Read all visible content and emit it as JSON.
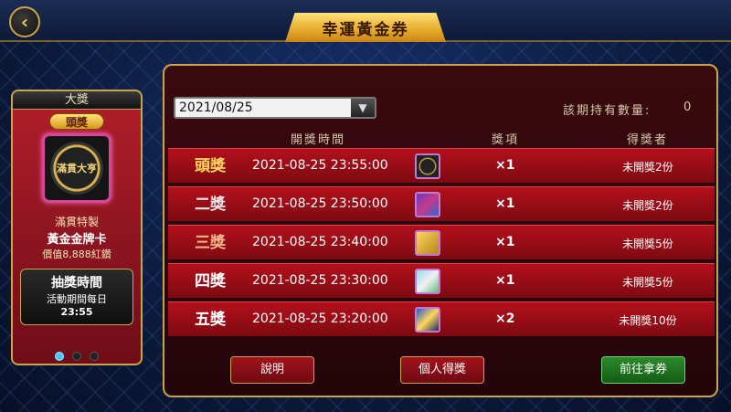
{
  "header": {
    "back_icon": "chevron-left-icon",
    "title": "幸運黃金券"
  },
  "prize_panel": {
    "header": "大獎",
    "badge": "頭獎",
    "card_icon": "casino-chip-icon",
    "card_text": "滿貫大亨",
    "name_line1": "滿貫特製",
    "name_line2": "黃金金牌卡",
    "value": "價值8,888紅鑽",
    "draw": {
      "title": "抽獎時間",
      "subtitle": "活動期間每日",
      "time": "23:55"
    },
    "carousel_active_index": 0
  },
  "main": {
    "date_selected": "2021/08/25",
    "quantity_label": "該期持有數量:",
    "quantity_value": "0",
    "columns": {
      "time": "開獎時間",
      "item": "獎項",
      "winner": "得獎者"
    },
    "rows": [
      {
        "rank": "頭獎",
        "style": "gold",
        "time": "2021-08-25 23:55:00",
        "icon": "chip-icon",
        "qty": "×1",
        "winner": "未開獎2份"
      },
      {
        "rank": "二獎",
        "style": "silver",
        "time": "2021-08-25 23:50:00",
        "icon": "card-pack-icon",
        "qty": "×1",
        "winner": "未開獎2份"
      },
      {
        "rank": "三獎",
        "style": "bronze",
        "time": "2021-08-25 23:40:00",
        "icon": "gold-card-icon",
        "qty": "×1",
        "winner": "未開獎5份"
      },
      {
        "rank": "四獎",
        "style": "plain",
        "time": "2021-08-25 23:30:00",
        "icon": "ticket-icon",
        "qty": "×1",
        "winner": "未開獎5份"
      },
      {
        "rank": "五獎",
        "style": "plain",
        "time": "2021-08-25 23:20:00",
        "icon": "coupon-icon",
        "qty": "×2",
        "winner": "未開獎10份"
      }
    ],
    "buttons": {
      "explain": "說明",
      "personal": "個人得獎",
      "redeem": "前往拿券"
    }
  }
}
